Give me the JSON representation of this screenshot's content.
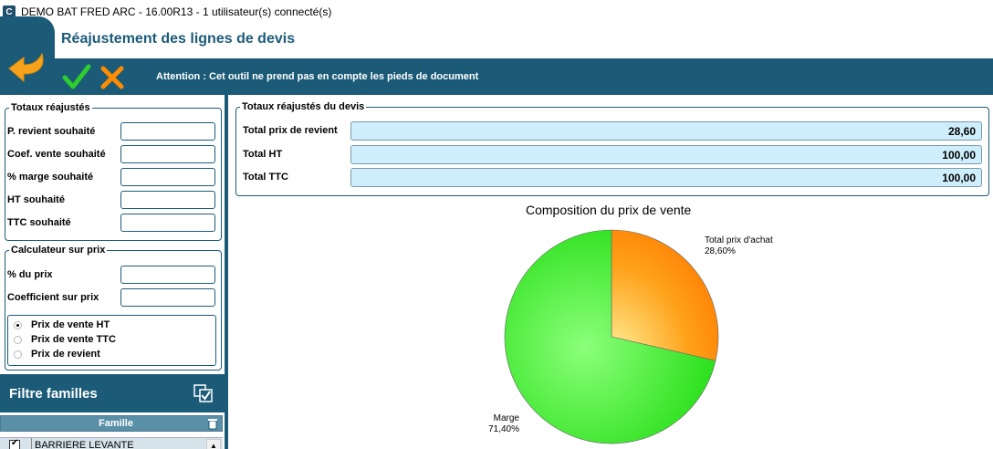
{
  "window": {
    "title": "DEMO BAT FRED ARC - 16.00R13 - 1 utilisateur(s) connecté(s)",
    "app_icon_letter": "C"
  },
  "header": {
    "title": "Réajustement des lignes de devis",
    "warning": "Attention : Cet outil ne prend pas en compte les pieds de document"
  },
  "totaux_reajustes": {
    "legend": "Totaux réajustés",
    "fields": [
      {
        "label": "P. revient souhaité",
        "value": ""
      },
      {
        "label": "Coef. vente souhaité",
        "value": ""
      },
      {
        "label": "% marge souhaité",
        "value": ""
      },
      {
        "label": "HT souhaité",
        "value": ""
      },
      {
        "label": "TTC souhaité",
        "value": ""
      }
    ]
  },
  "calculateur": {
    "legend": "Calculateur sur prix",
    "fields": [
      {
        "label": "% du prix",
        "value": ""
      },
      {
        "label": "Coefficient sur prix",
        "value": ""
      }
    ],
    "radios": [
      {
        "label": "Prix de vente HT",
        "checked": true
      },
      {
        "label": "Prix de vente TTC",
        "checked": false
      },
      {
        "label": "Prix de revient",
        "checked": false
      }
    ]
  },
  "filtre": {
    "title": "Filtre familles",
    "column": "Famille",
    "rows": [
      {
        "label": "BARRIERE LEVANTE",
        "checked": true
      }
    ]
  },
  "totaux_devis": {
    "legend": "Totaux réajustés du devis",
    "rows": [
      {
        "label": "Total prix de revient",
        "value": "28,60"
      },
      {
        "label": "Total HT",
        "value": "100,00"
      },
      {
        "label": "Total TTC",
        "value": "100,00"
      }
    ]
  },
  "chart_data": {
    "type": "pie",
    "title": "Composition du prix de vente",
    "slices": [
      {
        "name": "Total prix d'achat",
        "label": "28,60%",
        "value": 28.6,
        "color": "#ff8c00"
      },
      {
        "name": "Marge",
        "label": "71,40%",
        "value": 71.4,
        "color": "#33ee22"
      }
    ]
  },
  "colors": {
    "accent": "#1c5b78",
    "check": "#2ecc2e",
    "cross": "#ff8c00"
  }
}
